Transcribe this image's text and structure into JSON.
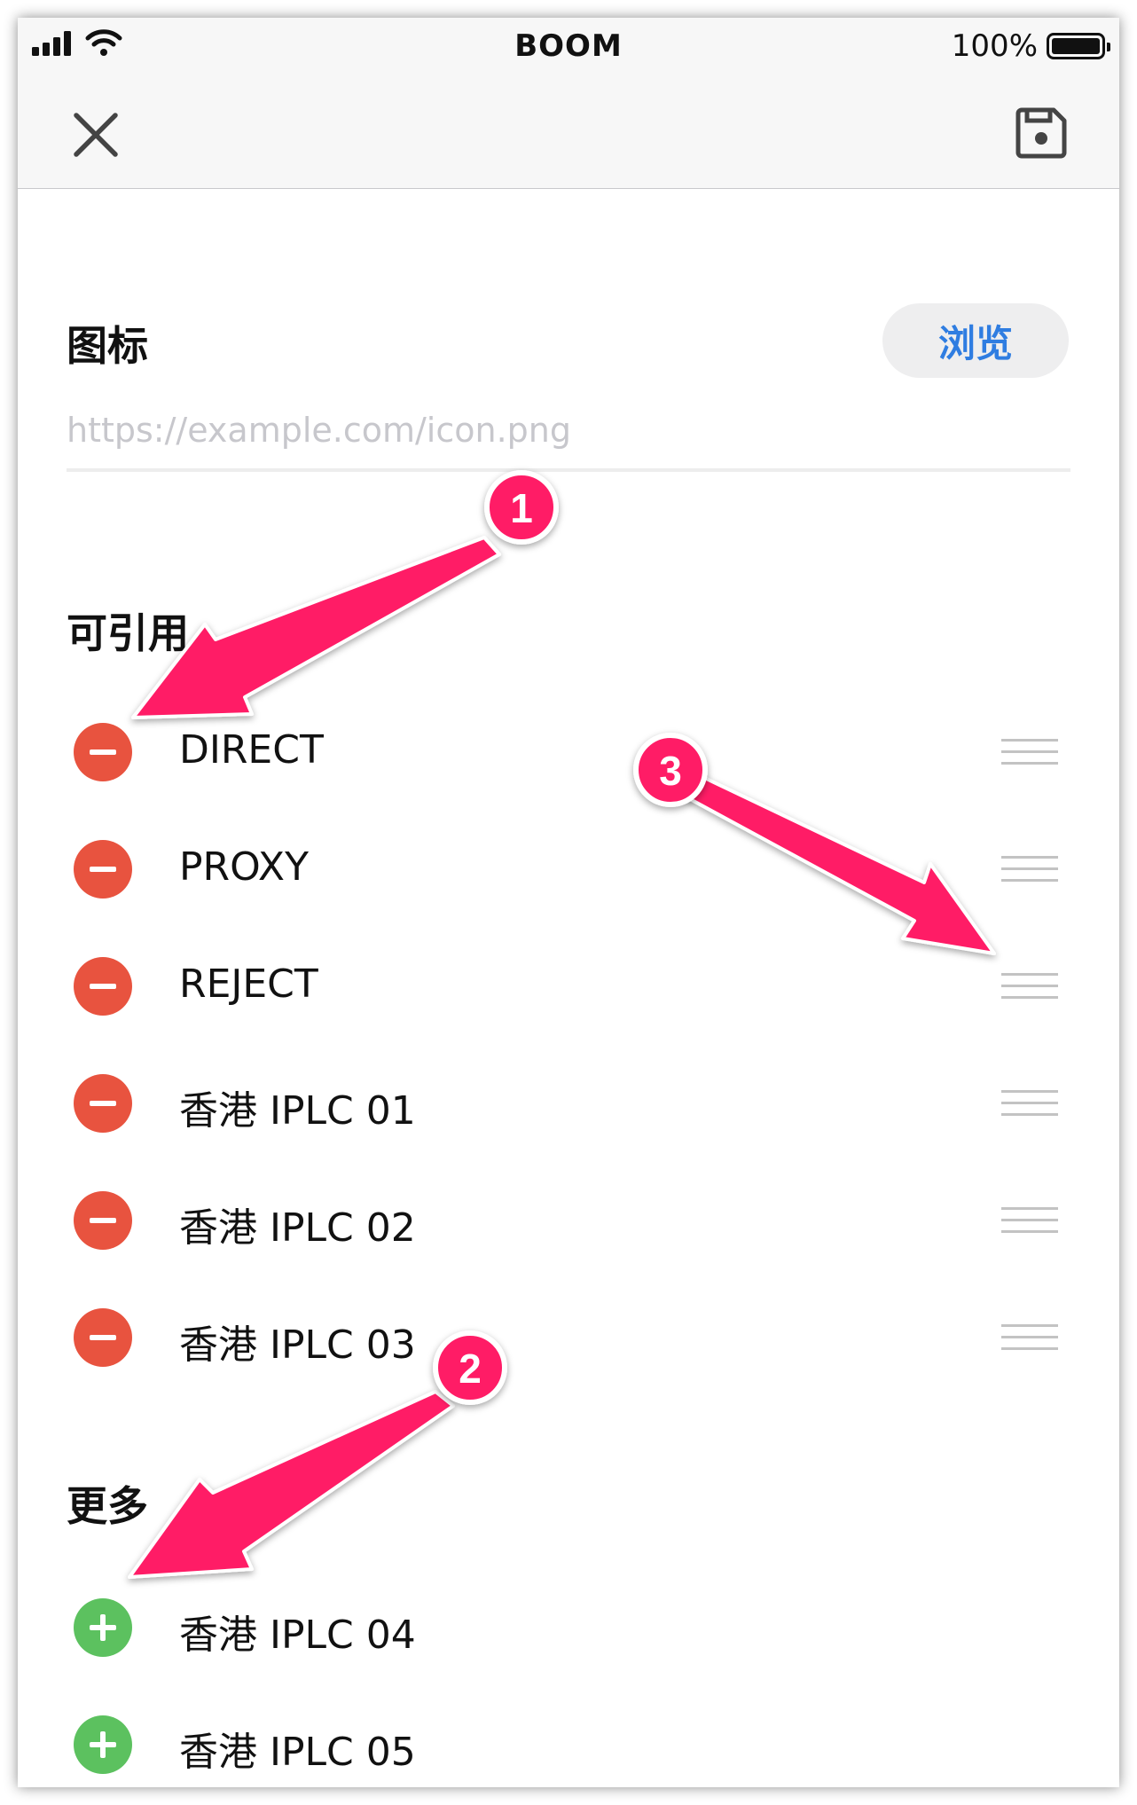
{
  "status_bar": {
    "carrier_title": "BOOM",
    "battery_percent": "100%"
  },
  "nav": {
    "close_icon": "close-icon",
    "save_icon": "save-icon"
  },
  "icon_section": {
    "label": "图标",
    "browse_button": "浏览",
    "input_value": "",
    "input_placeholder": "https://example.com/icon.png"
  },
  "referenced": {
    "label": "可引用",
    "items": [
      {
        "name": "DIRECT"
      },
      {
        "name": "PROXY"
      },
      {
        "name": "REJECT"
      },
      {
        "name": "香港 IPLC 01"
      },
      {
        "name": "香港 IPLC 02"
      },
      {
        "name": "香港 IPLC 03"
      }
    ]
  },
  "more": {
    "label": "更多",
    "items": [
      {
        "name": "香港 IPLC 04"
      },
      {
        "name": "香港 IPLC 05"
      }
    ]
  },
  "annotations": {
    "color": "#ff1a66",
    "markers": [
      "1",
      "2",
      "3"
    ]
  }
}
